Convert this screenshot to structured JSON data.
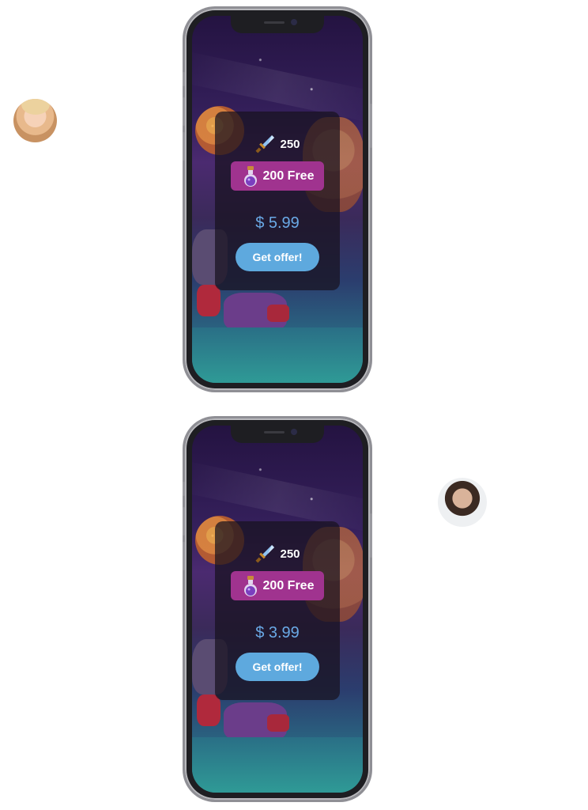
{
  "colors": {
    "card_bg": "#18121e",
    "pill_bg": "#a0338f",
    "price_text": "#6aa9e6",
    "button_bg": "#5ea9de"
  },
  "offers": [
    {
      "gem_count": "250",
      "free_label": "200 Free",
      "price": "$ 5.99",
      "button_label": "Get offer!"
    },
    {
      "gem_count": "250",
      "free_label": "200 Free",
      "price": "$ 3.99",
      "button_label": "Get offer!"
    }
  ],
  "icons": {
    "gem": "sword-icon",
    "bonus": "potion-icon"
  }
}
